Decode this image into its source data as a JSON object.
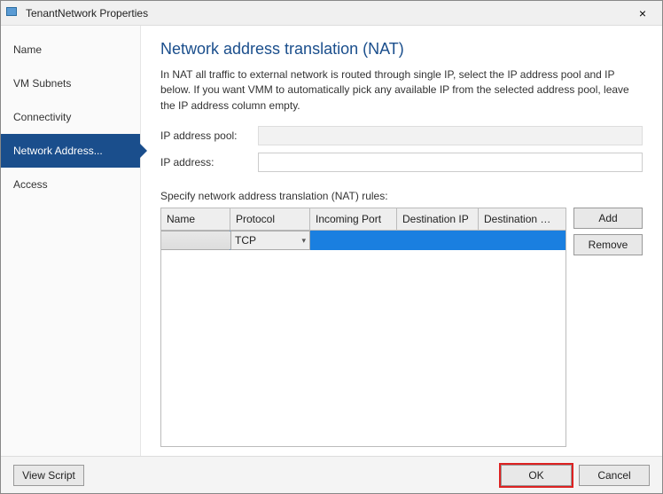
{
  "window": {
    "title": "TenantNetwork Properties",
    "close": "×"
  },
  "sidebar": {
    "items": [
      {
        "label": "Name"
      },
      {
        "label": "VM Subnets"
      },
      {
        "label": "Connectivity"
      },
      {
        "label": "Network Address..."
      },
      {
        "label": "Access"
      }
    ]
  },
  "main": {
    "heading": "Network address translation (NAT)",
    "description": "In NAT all traffic to external network is routed through single IP, select the IP address pool and IP below. If you want VMM to automatically pick any available IP from the selected address pool, leave the IP address column empty.",
    "ip_pool_label": "IP address pool:",
    "ip_pool_value": "",
    "ip_addr_label": "IP address:",
    "ip_addr_value": "",
    "rules_label": "Specify network address translation (NAT) rules:",
    "columns": {
      "name": "Name",
      "protocol": "Protocol",
      "incoming_port": "Incoming Port",
      "destination_ip": "Destination IP",
      "destination_port": "Destination P..."
    },
    "rows": [
      {
        "name": "",
        "protocol": "TCP",
        "incoming_port": "",
        "destination_ip": "",
        "destination_port": ""
      }
    ],
    "buttons": {
      "add": "Add",
      "remove": "Remove"
    }
  },
  "footer": {
    "view_script": "View Script",
    "ok": "OK",
    "cancel": "Cancel"
  }
}
